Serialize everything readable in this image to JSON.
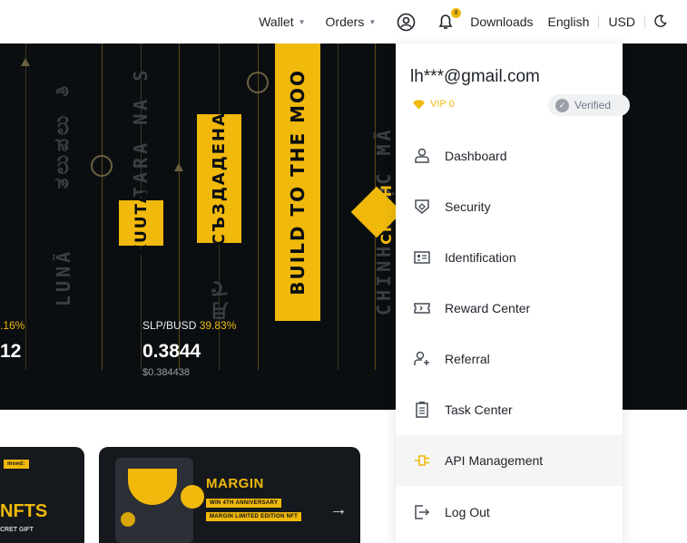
{
  "nav": {
    "wallet_label": "Wallet",
    "orders_label": "Orders",
    "notification_count": "8",
    "downloads_label": "Downloads",
    "language_label": "English",
    "currency_label": "USD"
  },
  "hero": {
    "tags": {
      "kuuta": "KUUTA",
      "sazdadena": "СЪЗДАДЕНА",
      "build": "BUILD TO THE MOO",
      "chinh": "CHINH"
    },
    "faded_texts": {
      "luna": "LUNÃ",
      "tara": "TARA NA S",
      "phuc": "CHINH PHỤC MĂ",
      "script1": "ತಲುಪಲು ತಿ",
      "kanji": "月で"
    },
    "tickers": [
      {
        "pair": "",
        "pct": ".16%",
        "price": "12",
        "usd": ""
      },
      {
        "pair": "SLP/BUSD",
        "pct": "39.83%",
        "price": "0.3844",
        "usd": "$0.384438"
      }
    ]
  },
  "cards": {
    "left": {
      "title": "NFTS",
      "pill_top": "moed:",
      "subtitle": "CRET GIFT"
    },
    "right": {
      "title": "MARGIN",
      "pill1": "WIN 4TH ANNIVERSARY",
      "pill2": "MARGIN LIMITED EDITION NFT"
    }
  },
  "menu": {
    "email": "lh***@gmail.com",
    "vip": "VIP 0",
    "verified": "Verified",
    "items": [
      {
        "label": "Dashboard",
        "icon": "user-icon"
      },
      {
        "label": "Security",
        "icon": "shield-icon"
      },
      {
        "label": "Identification",
        "icon": "id-card-icon"
      },
      {
        "label": "Reward Center",
        "icon": "ticket-icon"
      },
      {
        "label": "Referral",
        "icon": "add-user-icon"
      },
      {
        "label": "Task Center",
        "icon": "checklist-icon"
      },
      {
        "label": "API Management",
        "icon": "plug-icon"
      },
      {
        "label": "Log Out",
        "icon": "logout-icon"
      }
    ]
  },
  "colors": {
    "accent": "#f0b90b",
    "hero_bg": "#0b0e11",
    "text": "#1e2329",
    "muted": "#707a8a"
  }
}
